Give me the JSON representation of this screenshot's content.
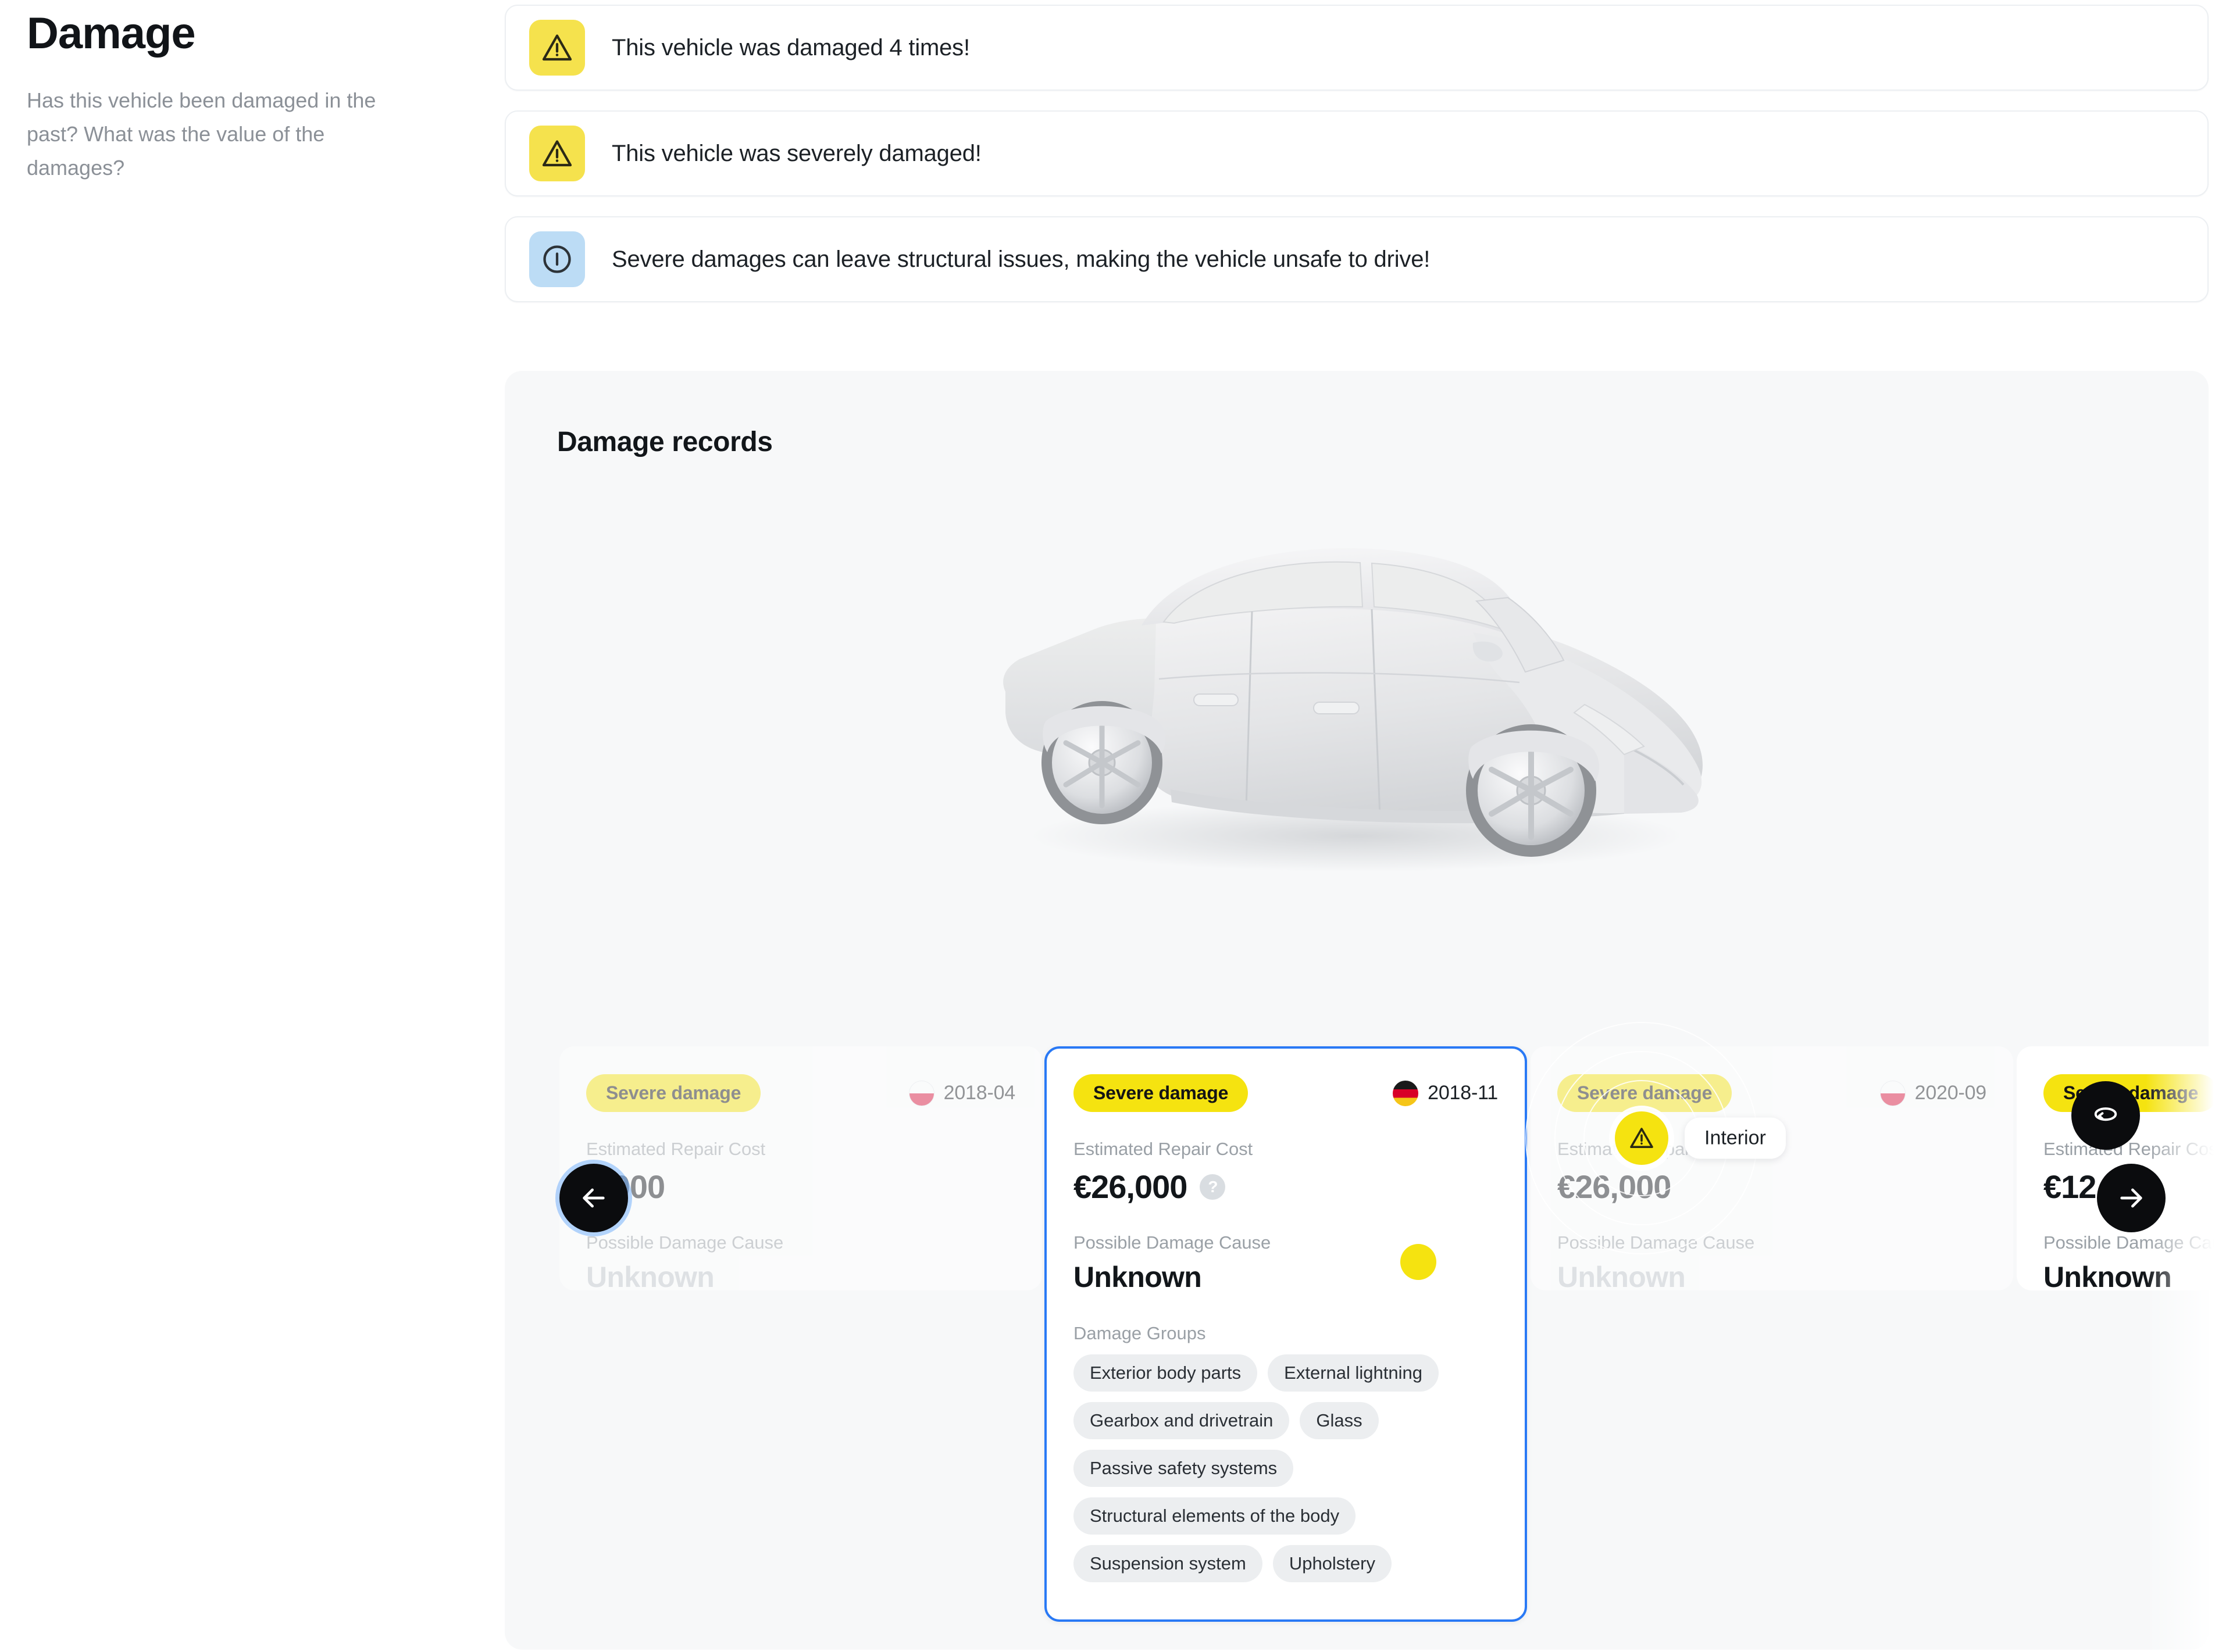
{
  "sidebar": {
    "title": "Damage",
    "subtitle": "Has this vehicle been damaged in the past? What was the value of the damages?"
  },
  "alerts": [
    {
      "icon": "warning-triangle-icon",
      "severity": "warning",
      "text": "This vehicle was damaged 4 times!"
    },
    {
      "icon": "warning-triangle-icon",
      "severity": "warning",
      "text": "This vehicle was severely damaged!"
    },
    {
      "icon": "info-circle-icon",
      "severity": "info",
      "text": "Severe damages can leave structural issues, making the vehicle unsafe to drive!"
    }
  ],
  "panel": {
    "title": "Damage records",
    "car_viewer": {
      "marker_label": "Interior",
      "marker_icon": "warning-triangle-icon",
      "rotate_button_icon": "rotate-3d-icon"
    },
    "labels": {
      "repair_cost": "Estimated Repair Cost",
      "damage_cause": "Possible Damage Cause",
      "damage_groups": "Damage Groups"
    },
    "nav": {
      "prev_icon": "arrow-left-icon",
      "next_icon": "arrow-right-icon"
    },
    "cards": [
      {
        "badge": "Severe damage",
        "flag": "pl",
        "date": "2018-04",
        "repair_cost": "5,000",
        "damage_cause": "Unknown",
        "selected": false,
        "dim": true
      },
      {
        "badge": "Severe damage",
        "flag": "de",
        "date": "2018-11",
        "repair_cost": "€26,000",
        "help_icon": "help-circle-icon",
        "damage_cause": "Unknown",
        "selected": true,
        "dim": false,
        "damage_groups": [
          "Exterior body parts",
          "External lightning",
          "Gearbox and drivetrain",
          "Glass",
          "Passive safety systems",
          "Structural elements of the body",
          "Suspension system",
          "Upholstery"
        ]
      },
      {
        "badge": "Severe damage",
        "flag": "pl",
        "date": "2020-09",
        "repair_cost": "€26,000",
        "damage_cause": "Unknown",
        "selected": false,
        "dim": true
      },
      {
        "badge": "Severe damage",
        "flag": "",
        "date": "",
        "repair_cost": "€12,    0",
        "damage_cause": "Unknown",
        "selected": false,
        "dim": false
      }
    ]
  },
  "colors": {
    "warning_yellow": "#F5E24D",
    "badge_yellow": "#F5E310",
    "info_blue": "#BCDCF5",
    "selected_border": "#2979F5",
    "panel_bg": "#F7F8F9",
    "text_primary": "#12161A",
    "text_muted": "#9AA0A6"
  }
}
